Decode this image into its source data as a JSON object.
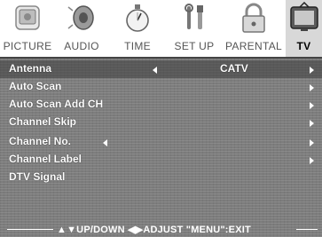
{
  "tabs": [
    {
      "label": "PICTURE",
      "icon": "picture-icon"
    },
    {
      "label": "AUDIO",
      "icon": "speaker-icon"
    },
    {
      "label": "TIME",
      "icon": "stopwatch-icon"
    },
    {
      "label": "SET UP",
      "icon": "tools-icon"
    },
    {
      "label": "PARENTAL",
      "icon": "lock-icon"
    },
    {
      "label": "TV",
      "icon": "tv-icon",
      "active": true
    }
  ],
  "menu": {
    "items": [
      {
        "label": "Antenna",
        "value": "CATV"
      },
      {
        "label": "Auto Scan"
      },
      {
        "label": "Auto Scan Add CH"
      },
      {
        "label": "Channel Skip"
      },
      {
        "label": "Channel No."
      },
      {
        "label": "Channel Label"
      },
      {
        "label": "DTV Signal"
      }
    ]
  },
  "footer": {
    "hint": "▲▼UP/DOWN  ◀▶ADJUST  \"MENU\":EXIT"
  },
  "colors": {
    "panel": "#7d7d7d",
    "text": "#ffffff",
    "active_tab": "#d8d8d8"
  }
}
